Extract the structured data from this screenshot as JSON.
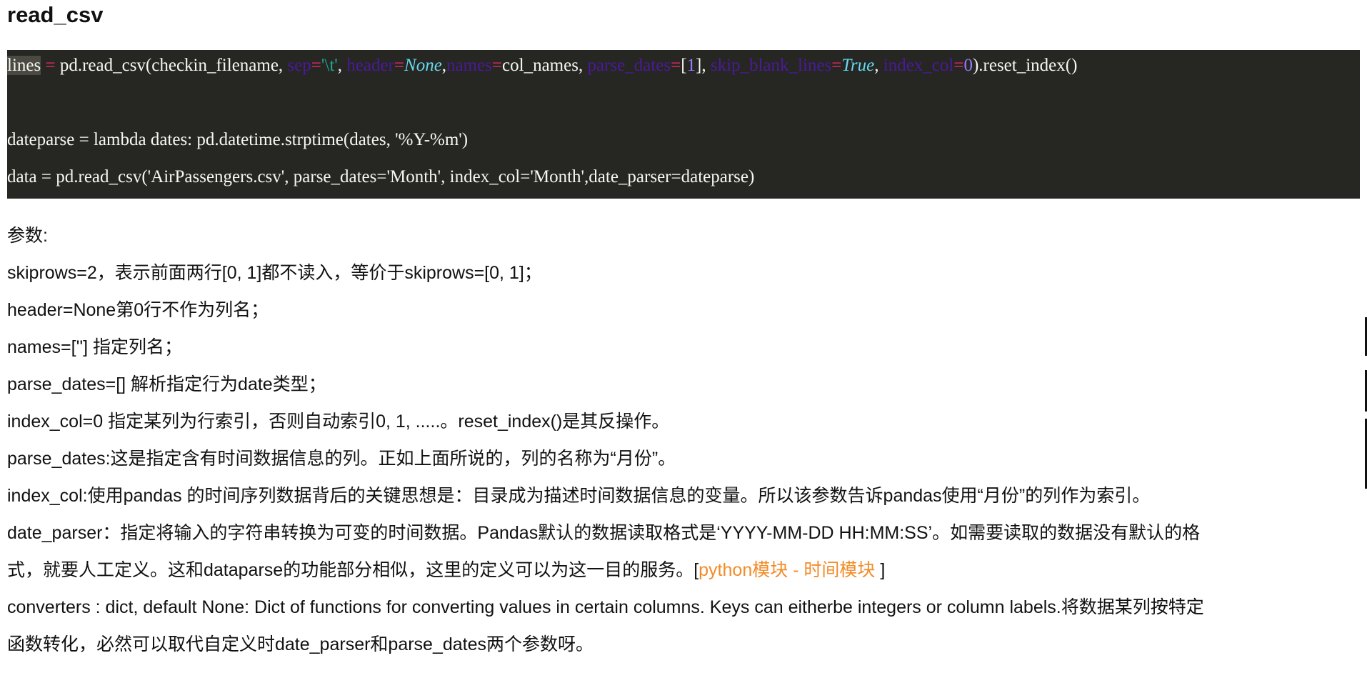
{
  "title": "read_csv",
  "code": {
    "line1": {
      "var": "lines",
      "eq": " = ",
      "call": "pd.read_csv(checkin_filename, ",
      "sep_kw": "sep",
      "sep_eq": "=",
      "sep_val": "'\\t'",
      "c1": ", ",
      "header_kw": "header",
      "header_eq": "=",
      "header_val": "None",
      "c2": ",",
      "names_kw": "names",
      "names_eq": "=",
      "names_val": "col_names, ",
      "pd_kw": "parse_dates",
      "pd_eq": "=",
      "pd_open": "[",
      "pd_num": "1",
      "pd_close": "], ",
      "sbl_kw": "skip_blank_lines",
      "sbl_eq": "=",
      "sbl_val": "True",
      "c3": ", ",
      "ic_kw": "index_col",
      "ic_eq": "=",
      "ic_num": "0",
      "tail": ").reset_index()"
    },
    "line3": "dateparse = lambda dates: pd.datetime.strptime(dates, '%Y-%m')",
    "line4": "data = pd.read_csv('AirPassengers.csv', parse_dates='Month', index_col='Month',date_parser=dateparse)"
  },
  "params_heading": "参数:",
  "params": {
    "skiprows": "skiprows=2，表示前面两行[0, 1]都不读入，等价于skiprows=[0, 1]；",
    "header": "header=None第0行不作为列名；",
    "names": "names=[''] 指定列名；",
    "parse_dates_list": "parse_dates=[]  解析指定行为date类型；",
    "index_col_0": "index_col=0   指定某列为行索引，否则自动索引0, 1, .....。reset_index()是其反操作。",
    "parse_dates_desc": "parse_dates:这是指定含有时间数据信息的列。正如上面所说的，列的名称为“月份”。",
    "index_col_desc": "index_col:使用pandas 的时间序列数据背后的关键思想是：目录成为描述时间数据信息的变量。所以该参数告诉pandas使用“月份”的列作为索引。",
    "date_parser_line1": "date_parser：指定将输入的字符串转换为可变的时间数据。Pandas默认的数据读取格式是‘YYYY-MM-DD HH:MM:SS’。如需要读取的数据没有默认的格",
    "date_parser_line2_prefix": "式，就要人工定义。这和dataparse的功能部分相似，这里的定义可以为这一目的服务。[",
    "date_parser_link": "python模块 - 时间模块",
    "date_parser_line2_suffix": " ]",
    "converters_line1": "converters : dict, default None: Dict of functions for converting values in certain columns. Keys can eitherbe integers or column labels.将数据某列按特定",
    "converters_line2": "函数转化，必然可以取代自定义时date_parser和parse_dates两个参数呀。"
  },
  "colors": {
    "code_bg": "#262622",
    "keyword_op": "#f92672",
    "param_name": "#4b1a9b",
    "string": "#1fa894",
    "number": "#9b7bff",
    "constant": "#66d9ef",
    "link": "#f28c28"
  }
}
